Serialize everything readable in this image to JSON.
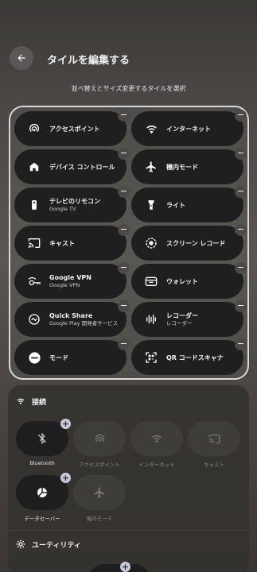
{
  "header": {
    "title": "タイルを編集する",
    "subtitle": "並べ替えとサイズ変更するタイルを選択"
  },
  "active_tiles": [
    {
      "label": "アクセスポイント",
      "sub": "",
      "icon": "hotspot-icon"
    },
    {
      "label": "インターネット",
      "sub": "",
      "icon": "wifi-icon"
    },
    {
      "label": "デバイス コントロール",
      "sub": "",
      "icon": "home-icon"
    },
    {
      "label": "機内モード",
      "sub": "",
      "icon": "airplane-icon"
    },
    {
      "label": "テレビのリモコン",
      "sub": "Google TV",
      "icon": "remote-icon"
    },
    {
      "label": "ライト",
      "sub": "",
      "icon": "flashlight-icon"
    },
    {
      "label": "キャスト",
      "sub": "",
      "icon": "cast-icon"
    },
    {
      "label": "スクリーン レコード",
      "sub": "",
      "icon": "screen-record-icon"
    },
    {
      "label": "Google VPN",
      "sub": "Google VPN",
      "icon": "vpn-key-icon"
    },
    {
      "label": "ウォレット",
      "sub": "",
      "icon": "wallet-icon"
    },
    {
      "label": "Quick Share",
      "sub": "Google Play 開発者サービス",
      "icon": "quick-share-icon"
    },
    {
      "label": "レコーダー",
      "sub": "レコーダー",
      "icon": "recorder-icon"
    },
    {
      "label": "モード",
      "sub": "",
      "icon": "dnd-mode-icon"
    },
    {
      "label": "QR コードスキャナ",
      "sub": "",
      "icon": "qr-scanner-icon"
    }
  ],
  "available": {
    "connection_label": "接続",
    "connection_tiles": [
      {
        "label": "Bluetooth",
        "icon": "bluetooth-off-icon",
        "enabled": true
      },
      {
        "label": "アクセスポイント",
        "icon": "hotspot-icon",
        "enabled": false
      },
      {
        "label": "インターネット",
        "icon": "wifi-icon",
        "enabled": false
      },
      {
        "label": "キャスト",
        "icon": "cast-icon",
        "enabled": false
      },
      {
        "label": "データセーバー",
        "icon": "data-saver-icon",
        "enabled": true
      },
      {
        "label": "機内モード",
        "icon": "airplane-icon",
        "enabled": false
      }
    ],
    "utility_label": "ユーティリティ"
  },
  "badges": {
    "remove": "−",
    "add": "+"
  }
}
